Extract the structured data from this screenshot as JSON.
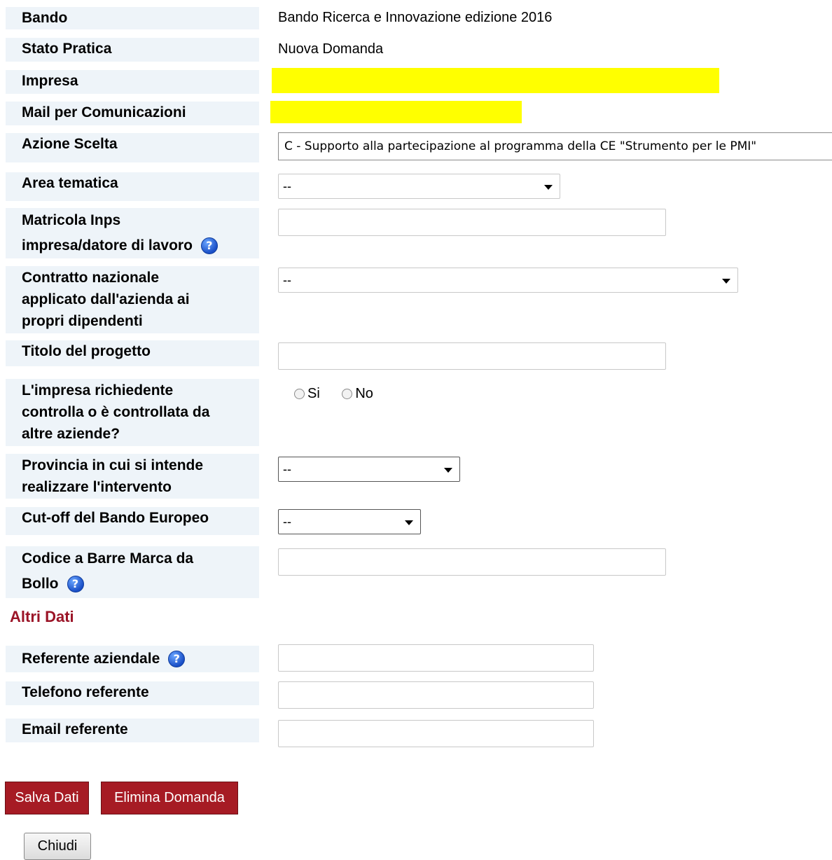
{
  "form": {
    "bando": {
      "label": "Bando",
      "value": "Bando Ricerca e Innovazione edizione 2016"
    },
    "stato": {
      "label": "Stato Pratica",
      "value": "Nuova Domanda"
    },
    "impresa": {
      "label": "Impresa"
    },
    "mail": {
      "label": "Mail per Comunicazioni"
    },
    "azione": {
      "label": "Azione Scelta",
      "value": "C - Supporto alla partecipazione al programma della CE \"Strumento per le PMI\""
    },
    "area": {
      "label": "Area tematica",
      "value": "--"
    },
    "matricola": {
      "label_1": "Matricola Inps",
      "label_2": "impresa/datore di lavoro"
    },
    "contratto": {
      "label_1": "Contratto nazionale",
      "label_2": "applicato dall'azienda ai",
      "label_3": "propri dipendenti",
      "value": "--"
    },
    "titolo": {
      "label": "Titolo del progetto"
    },
    "controllo": {
      "label_1": "L'impresa richiedente",
      "label_2": "controlla o è controllata da",
      "label_3": "altre aziende?",
      "opt_si": "Si",
      "opt_no": "No"
    },
    "provincia": {
      "label_1": "Provincia in cui si intende",
      "label_2": "realizzare l'intervento",
      "value": "--"
    },
    "cutoff": {
      "label": "Cut-off del Bando Europeo",
      "value": "--"
    },
    "codice": {
      "label_1": "Codice a Barre Marca da",
      "label_2": "Bollo"
    }
  },
  "altri": {
    "title": "Altri Dati",
    "referente": {
      "label": "Referente aziendale"
    },
    "telefono": {
      "label": "Telefono referente"
    },
    "email": {
      "label": "Email referente"
    }
  },
  "buttons": {
    "salva": "Salva Dati",
    "elimina": "Elimina Domanda",
    "chiudi": "Chiudi"
  },
  "help_icon": "?",
  "colors": {
    "label_bg": "#eef4f9",
    "redacted": "#ffff00",
    "button_red": "#a61b24",
    "section_title": "#9b1427"
  }
}
